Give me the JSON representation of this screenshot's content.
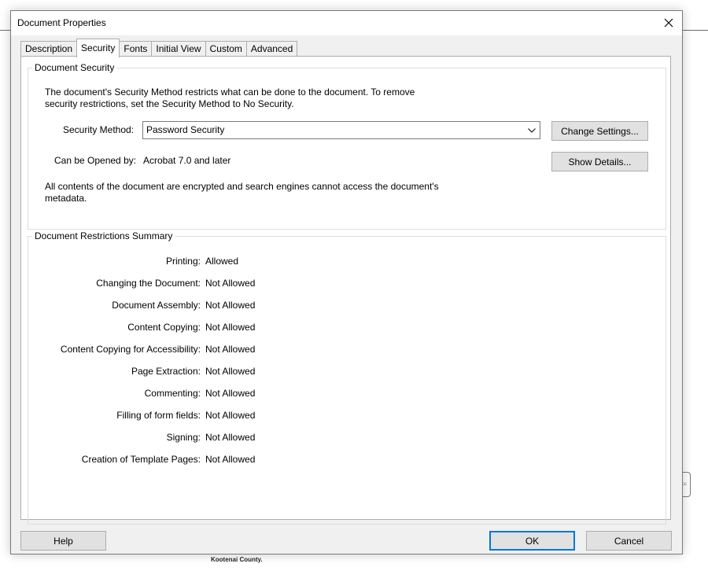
{
  "background": {
    "caption": "Kootenai County.",
    "widget_text": "cc"
  },
  "dialog": {
    "title": "Document Properties",
    "close_label": "×"
  },
  "tabs": [
    {
      "label": "Description",
      "active": false
    },
    {
      "label": "Security",
      "active": true
    },
    {
      "label": "Fonts",
      "active": false
    },
    {
      "label": "Initial View",
      "active": false
    },
    {
      "label": "Custom",
      "active": false
    },
    {
      "label": "Advanced",
      "active": false
    }
  ],
  "security": {
    "group_title": "Document Security",
    "intro_text": "The document's Security Method restricts what can be done to the document. To remove security restrictions, set the Security Method to No Security.",
    "method_label": "Security Method:",
    "method_value": "Password Security",
    "change_settings_label": "Change Settings...",
    "opened_by_label": "Can be Opened by:",
    "opened_by_value": "Acrobat 7.0 and later",
    "show_details_label": "Show Details...",
    "encryption_text": "All contents of the document are encrypted and search engines cannot access the document's metadata."
  },
  "restrictions": {
    "group_title": "Document Restrictions Summary",
    "rows": [
      {
        "label": "Printing:",
        "value": "Allowed"
      },
      {
        "label": "Changing the Document:",
        "value": "Not Allowed"
      },
      {
        "label": "Document Assembly:",
        "value": "Not Allowed"
      },
      {
        "label": "Content Copying:",
        "value": "Not Allowed"
      },
      {
        "label": "Content Copying for Accessibility:",
        "value": "Not Allowed"
      },
      {
        "label": "Page Extraction:",
        "value": "Not Allowed"
      },
      {
        "label": "Commenting:",
        "value": "Not Allowed"
      },
      {
        "label": "Filling of form fields:",
        "value": "Not Allowed"
      },
      {
        "label": "Signing:",
        "value": "Not Allowed"
      },
      {
        "label": "Creation of Template Pages:",
        "value": "Not Allowed"
      }
    ]
  },
  "footer": {
    "help_label": "Help",
    "ok_label": "OK",
    "cancel_label": "Cancel"
  },
  "colors": {
    "dialog_bg": "#f0f0f0",
    "button_bg": "#e1e1e1",
    "default_button_border": "#0078d7"
  }
}
